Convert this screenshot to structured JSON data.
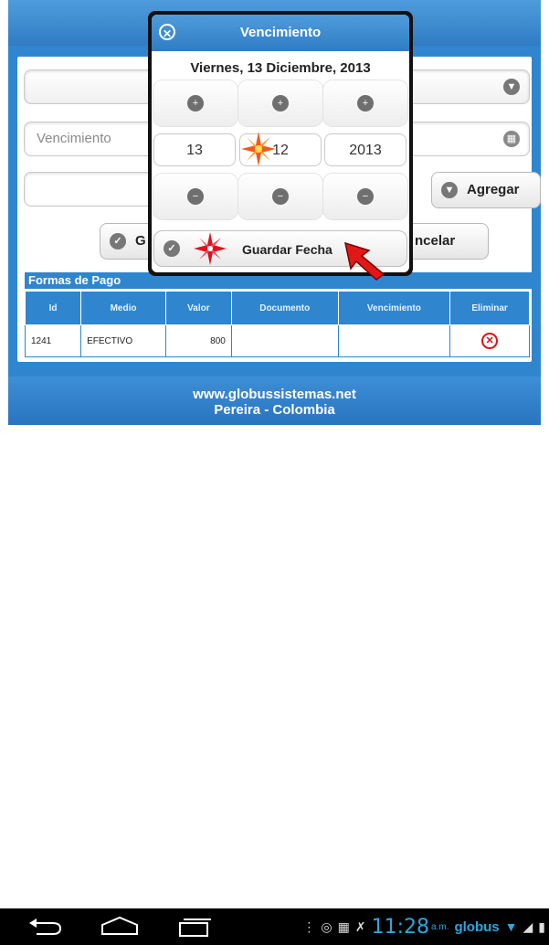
{
  "form": {
    "vencimiento_placeholder": "Vencimiento",
    "agregar_label": "Agregar",
    "guardar_label_partial": "G",
    "cancelar_label_partial": "ncelar"
  },
  "payments": {
    "title": "Formas de Pago",
    "columns": [
      "Id",
      "Medio",
      "Valor",
      "Documento",
      "Vencimiento",
      "Eliminar"
    ],
    "rows": [
      {
        "id": "1241",
        "medio": "EFECTIVO",
        "valor": "800",
        "documento": "",
        "vencimiento": ""
      }
    ]
  },
  "footer": {
    "line1": "www.globussistemas.net",
    "line2": "Pereira - Colombia"
  },
  "dialog": {
    "title": "Vencimiento",
    "date_text": "Viernes, 13 Diciembre, 2013",
    "day": "13",
    "month": "12",
    "year": "2013",
    "save_label": "Guardar Fecha"
  },
  "statusbar": {
    "time": "11:28",
    "ampm": "a.m.",
    "carrier": "globus"
  },
  "colors": {
    "accent_blue": "#2f86cf",
    "status_blue": "#2aa7e0",
    "delete_red": "#d11111"
  }
}
